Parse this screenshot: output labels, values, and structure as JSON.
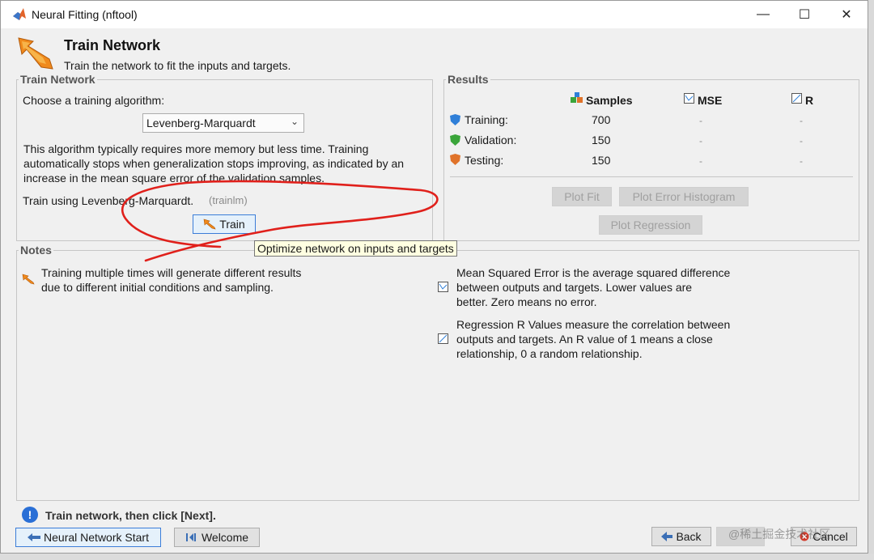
{
  "window": {
    "title": "Neural Fitting (nftool)",
    "controls": {
      "minimize": "—",
      "maximize": "☐",
      "close": "✕"
    }
  },
  "header": {
    "title": "Train Network",
    "subtitle": "Train the network to fit the inputs and targets."
  },
  "train_panel": {
    "label": "Train Network",
    "choose_label": "Choose a training algorithm:",
    "algorithm_selected": "Levenberg-Marquardt",
    "description_lines": [
      "This algorithm typically requires more memory but less time. Training",
      "automatically stops when generalization stops improving, as indicated by an",
      "increase in the mean square error of the validation samples."
    ],
    "train_using": "Train using Levenberg-Marquardt.",
    "train_fn": "(trainlm)",
    "train_button": "Train",
    "tooltip": "Optimize network on inputs and targets"
  },
  "results_panel": {
    "label": "Results",
    "headers": {
      "samples": "Samples",
      "mse": "MSE",
      "r": "R"
    },
    "rows": [
      {
        "label": "Training:",
        "samples": "700",
        "mse": "-",
        "r": "-",
        "color": "#2f7fd8"
      },
      {
        "label": "Validation:",
        "samples": "150",
        "mse": "-",
        "r": "-",
        "color": "#3aa53a"
      },
      {
        "label": "Testing:",
        "samples": "150",
        "mse": "-",
        "r": "-",
        "color": "#e0732a"
      }
    ],
    "buttons": {
      "plot_fit": "Plot Fit",
      "plot_error_histogram": "Plot Error Histogram",
      "plot_regression": "Plot Regression"
    }
  },
  "notes_panel": {
    "label": "Notes",
    "note_left_lines": [
      "Training multiple times will generate different results",
      "due to different initial conditions and sampling."
    ],
    "note_mse_lines": [
      "Mean Squared Error is the average squared difference",
      "between outputs and targets. Lower values are",
      "better. Zero means no error."
    ],
    "note_r_lines": [
      "Regression R Values measure the correlation between",
      "outputs and targets. An R value of 1 means a close",
      "relationship, 0 a random relationship."
    ]
  },
  "footer": {
    "status": "Train network, then click [Next].",
    "nn_start": "Neural Network Start",
    "welcome": "Welcome",
    "back": "Back",
    "cancel": "Cancel",
    "watermark": "@稀土掘金技术社区"
  },
  "colors": {
    "annotation_red": "#e0201b",
    "accent_blue": "#2a6fd6"
  }
}
